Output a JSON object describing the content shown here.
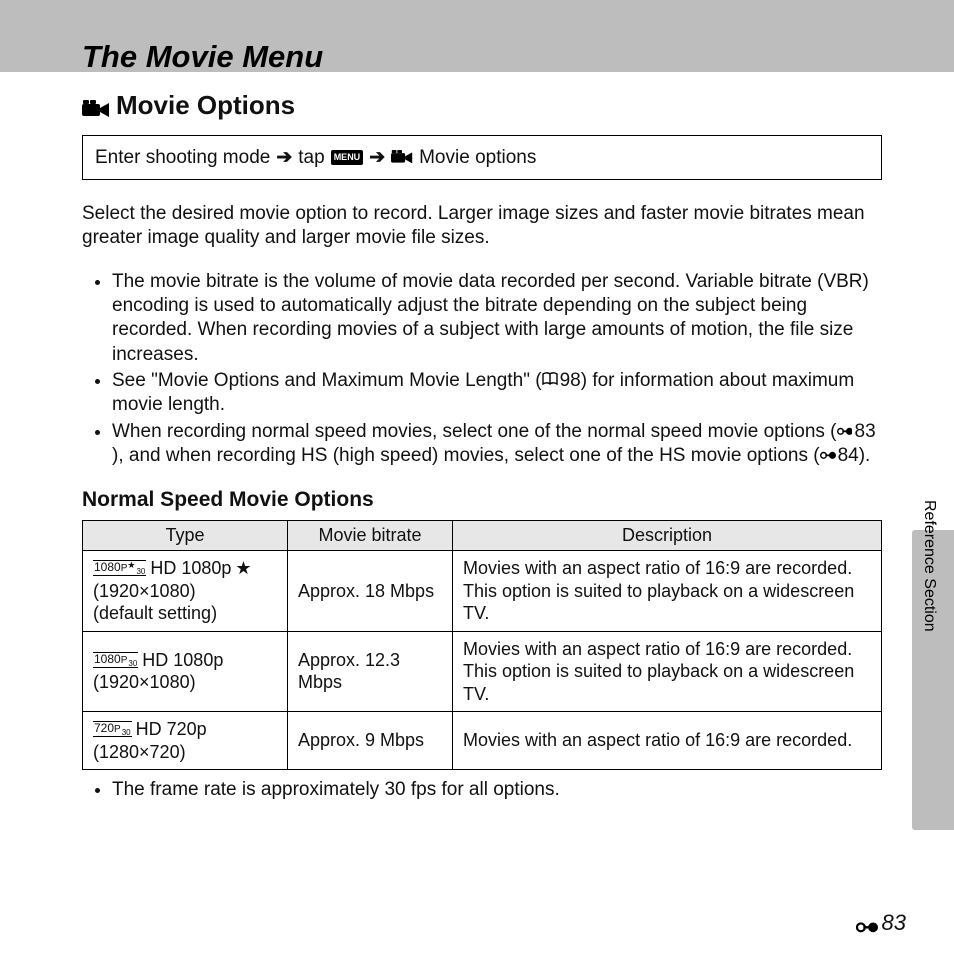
{
  "header": {
    "title": "The Movie Menu"
  },
  "subheading": {
    "label": "Movie Options"
  },
  "instruction": {
    "part1": "Enter shooting mode",
    "tap": "tap",
    "menu_icon": "MENU",
    "part2": "Movie options"
  },
  "intro": "Select the desired movie option to record. Larger image sizes and faster movie bitrates mean greater image quality and larger movie file sizes.",
  "bullets": [
    {
      "text": "The movie bitrate is the volume of movie data recorded per second. Variable bitrate (VBR) encoding is used to automatically adjust the bitrate depending on the subject being recorded. When recording movies of a subject with large amounts of motion, the file size increases."
    },
    {
      "pre": "See \"Movie Options and Maximum Movie Length\" (",
      "ref": "98",
      "post": ") for information about maximum movie length.",
      "ref_type": "book"
    },
    {
      "pre": "When recording normal speed movies, select one of the normal speed movie options (",
      "ref": "83",
      "mid": "), and when recording HS (high speed) movies, select one of the HS movie options (",
      "ref2": "84",
      "post": ").",
      "ref_type": "pager"
    }
  ],
  "section": {
    "heading": "Normal Speed Movie Options"
  },
  "table": {
    "headers": {
      "type": "Type",
      "bitrate": "Movie bitrate",
      "desc": "Description"
    },
    "rows": [
      {
        "icon_text": "1080P★30",
        "star": "★",
        "name": "HD 1080p",
        "res": "(1920×1080)",
        "extra": "(default setting)",
        "bitrate": "Approx. 18 Mbps",
        "desc": "Movies with an aspect ratio of 16:9 are recorded. This option is suited to playback on a widescreen TV."
      },
      {
        "icon_text": "1080P30",
        "star": "",
        "name": "HD 1080p",
        "res": "(1920×1080)",
        "extra": "",
        "bitrate": "Approx. 12.3 Mbps",
        "desc": "Movies with an aspect ratio of 16:9 are recorded. This option is suited to playback on a widescreen TV."
      },
      {
        "icon_text": "720P30",
        "star": "",
        "name": "HD 720p",
        "res": "(1280×720)",
        "extra": "",
        "bitrate": "Approx. 9 Mbps",
        "desc": "Movies with an aspect ratio of 16:9 are recorded."
      }
    ]
  },
  "footnote": "The frame rate is approximately 30 fps for all options.",
  "side": {
    "label": "Reference Section"
  },
  "page_number": "83"
}
